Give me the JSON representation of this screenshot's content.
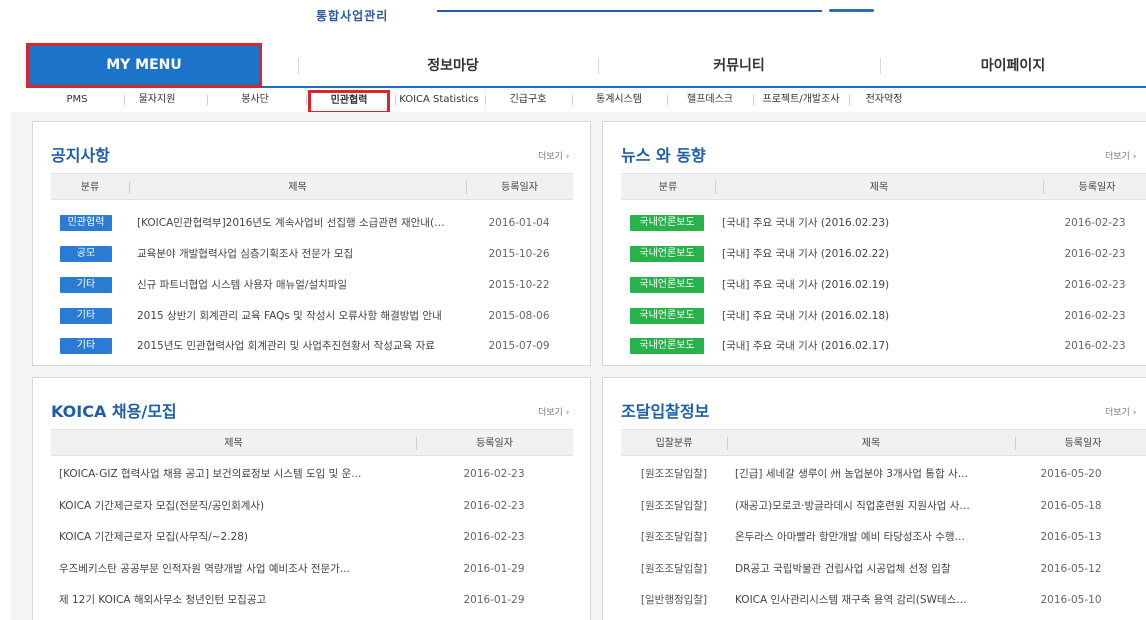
{
  "header": {
    "site_title": "통합사업관리"
  },
  "main_nav": [
    "MY MENU",
    "정보마당",
    "커뮤니티",
    "마이페이지"
  ],
  "sub_nav": [
    "PMS",
    "물자지원",
    "봉사단",
    "민관협력",
    "KOICA Statistics",
    "긴급구호",
    "통계시스템",
    "헬프데스크",
    "프로젝트/개발조사",
    "전자약정"
  ],
  "notice": {
    "title": "공지사항",
    "more": "더보기 ›",
    "headers": [
      "분류",
      "제목",
      "등록일자"
    ],
    "rows": [
      {
        "cat": "민관협력",
        "title": "[KOICA민관협력부]2016년도 계속사업비 선집행 소급관련 재안내(…",
        "date": "2016-01-04"
      },
      {
        "cat": "공모",
        "title": "교육분야 개발협력사업 심층기획조사 전문가 모집",
        "date": "2015-10-26"
      },
      {
        "cat": "기타",
        "title": "신규 파트너협업 시스템 사용자 매뉴얼/설치파일",
        "date": "2015-10-22"
      },
      {
        "cat": "기타",
        "title": "2015 상반기 회계관리 교육 FAQs 및 작성시 오류사항 해결방법 안내",
        "date": "2015-08-06"
      },
      {
        "cat": "기타",
        "title": "2015년도 민관협력사업 회계관리 및 사업추진현황서 작성교육 자료",
        "date": "2015-07-09"
      }
    ]
  },
  "news": {
    "title": "뉴스 와 동향",
    "more": "더보기 ›",
    "headers": [
      "분류",
      "제목",
      "등록일자"
    ],
    "rows": [
      {
        "cat": "국내언론보도",
        "title": "[국내] 주요 국내 기사 (2016.02.23)",
        "date": "2016-02-23"
      },
      {
        "cat": "국내언론보도",
        "title": "[국내] 주요 국내 기사 (2016.02.22)",
        "date": "2016-02-23"
      },
      {
        "cat": "국내언론보도",
        "title": "[국내] 주요 국내 기사 (2016.02.19)",
        "date": "2016-02-23"
      },
      {
        "cat": "국내언론보도",
        "title": "[국내] 주요 국내 기사 (2016.02.18)",
        "date": "2016-02-23"
      },
      {
        "cat": "국내언론보도",
        "title": "[국내] 주요 국내 기사 (2016.02.17)",
        "date": "2016-02-23"
      }
    ]
  },
  "recruit": {
    "title": "KOICA 채용/모집",
    "more": "더보기 ›",
    "headers": [
      "제목",
      "등록일자"
    ],
    "rows": [
      {
        "title": "[KOICA-GIZ 협력사업 채용 공고] 보건의료정보 시스템 도입 및 운...",
        "date": "2016-02-23"
      },
      {
        "title": "KOICA 기간제근로자 모집(전문직/공인회계사)",
        "date": "2016-02-23"
      },
      {
        "title": "KOICA 기간제근로자 모집(사무직/~2.28)",
        "date": "2016-02-23"
      },
      {
        "title": "우즈베키스탄 공공부문 인적자원 역량개발 사업 예비조사 전문가...",
        "date": "2016-01-29"
      },
      {
        "title": "제 12기 KOICA 해외사무소 청년인턴 모집공고",
        "date": "2016-01-29"
      }
    ]
  },
  "bid": {
    "title": "조달입찰정보",
    "more": "더보기 ›",
    "headers": [
      "입찰분류",
      "제목",
      "등록일자"
    ],
    "rows": [
      {
        "cat": "[원조조달입찰]",
        "title": "[긴급] 세네갈 생루이 州 농업분야 3개사업 통합 사…",
        "date": "2016-05-20"
      },
      {
        "cat": "[원조조달입찰]",
        "title": "(재공고)모로코·방글라데시 직업훈련원 지원사업 사…",
        "date": "2016-05-18"
      },
      {
        "cat": "[원조조달입찰]",
        "title": "온두라스 아마빨라 항만개발 예비 타당성조사 수행…",
        "date": "2016-05-13"
      },
      {
        "cat": "[원조조달입찰]",
        "title": "DR공고 국립박물관 건립사업 시공업체 선정 입찰",
        "date": "2016-05-12"
      },
      {
        "cat": "[일반행정입찰]",
        "title": "KOICA 인사관리시스템 재구축 용역 감리(SW테스…",
        "date": "2016-05-10"
      }
    ]
  }
}
